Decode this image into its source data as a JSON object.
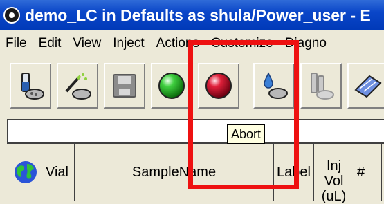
{
  "window": {
    "title": "demo_LC in Defaults as shula/Power_user - E"
  },
  "menubar": {
    "items": [
      "File",
      "Edit",
      "View",
      "Inject",
      "Actions",
      "Customize",
      "Diagno"
    ]
  },
  "toolbar": {
    "buttons": [
      {
        "icon": "vial-tray-icon"
      },
      {
        "icon": "magic-wand-tray-icon"
      },
      {
        "icon": "save-disk-icon"
      },
      {
        "icon": "green-start-icon"
      },
      {
        "icon": "red-abort-icon"
      },
      {
        "icon": "drop-tray-icon"
      },
      {
        "icon": "vials-icon"
      },
      {
        "icon": "plate-icon"
      }
    ],
    "tooltip": "Abort"
  },
  "table": {
    "headers": {
      "vial": "Vial",
      "sample_name": "SampleName",
      "label": "Label",
      "inj_vol_line1": "Inj",
      "inj_vol_line2": "Vol",
      "inj_vol_line3": "(uL)",
      "more": "#"
    }
  },
  "colors": {
    "title_bar": "#0a46c8",
    "highlight": "#ee1111",
    "tooltip_bg": "#ffffe1"
  }
}
